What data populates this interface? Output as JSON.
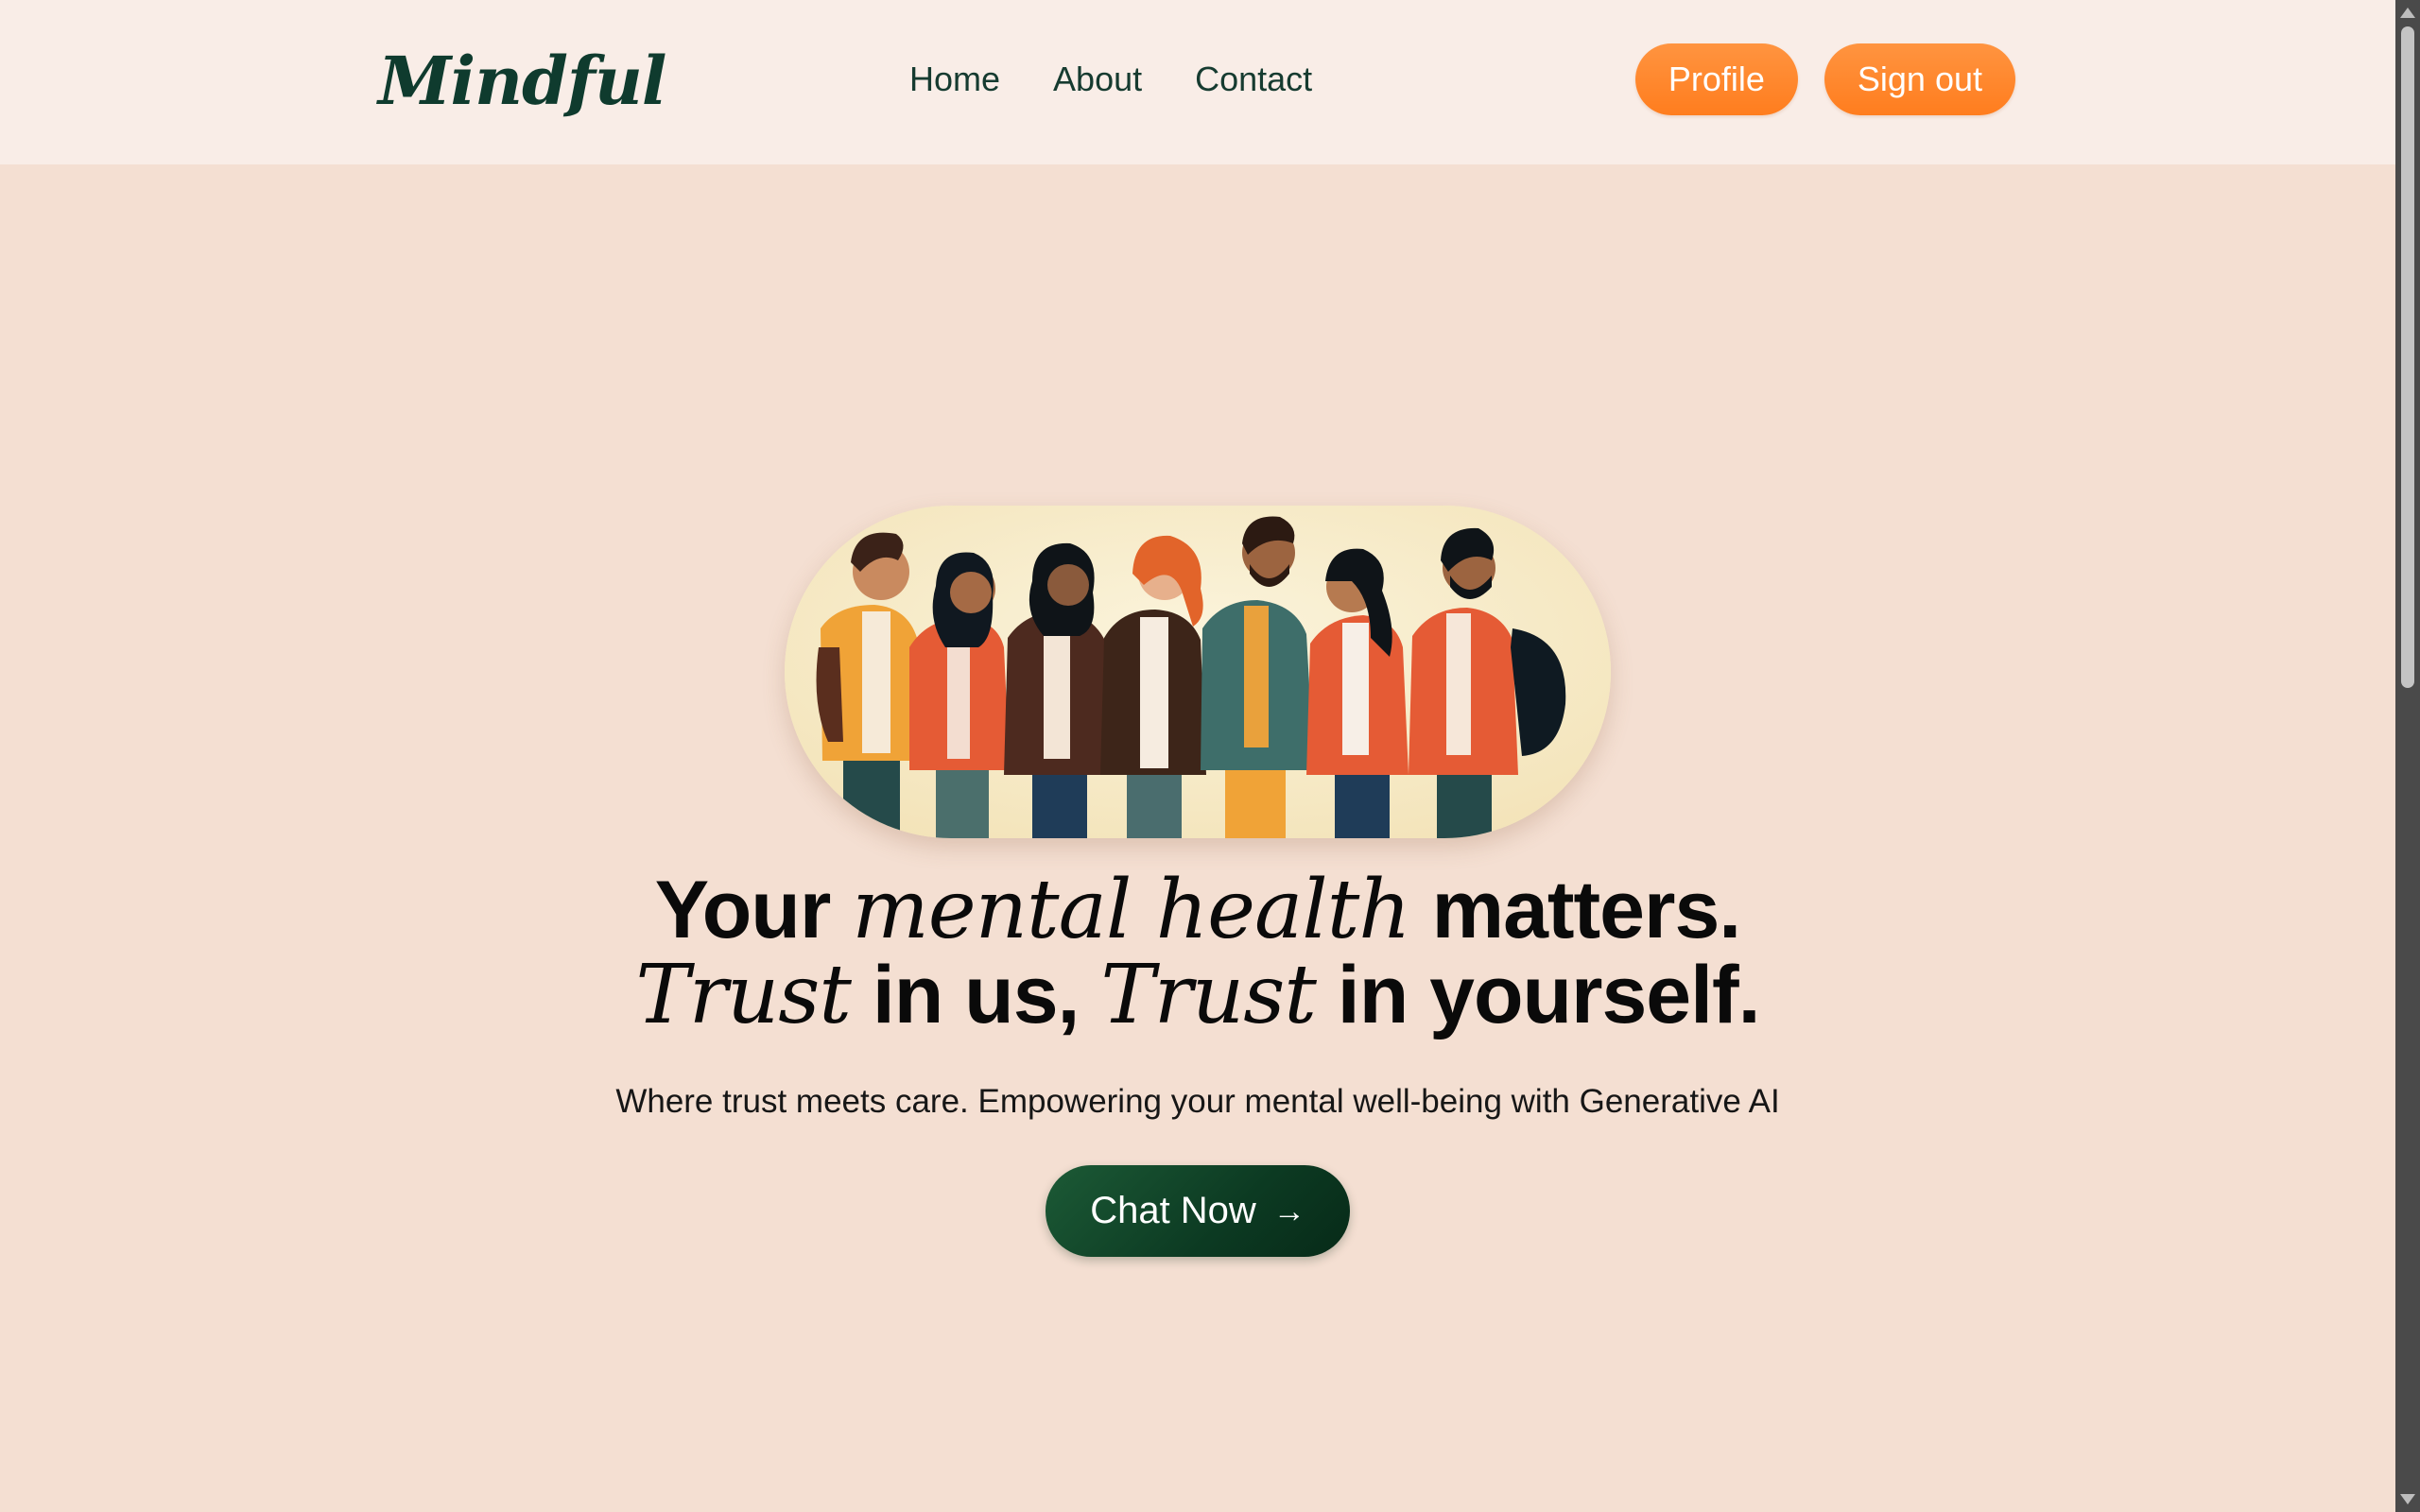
{
  "brand": {
    "name": "Mindful"
  },
  "nav": {
    "links": [
      {
        "label": "Home"
      },
      {
        "label": "About"
      },
      {
        "label": "Contact"
      }
    ]
  },
  "actions": {
    "profile_label": "Profile",
    "signout_label": "Sign out"
  },
  "hero": {
    "image_icon": "group-of-people-illustration",
    "headline": {
      "line1_a": "Your ",
      "line1_serif": "mental health",
      "line1_b": " matters.",
      "line2_serif_a": "Trust",
      "line2_a": " in us, ",
      "line2_serif_b": "Trust",
      "line2_b": " in yourself."
    },
    "subtitle": "Where trust meets care. Empowering your mental well-being with Generative AI",
    "cta_label": "Chat Now",
    "cta_icon": "arrow-right-icon"
  },
  "colors": {
    "page_background": "#f4dfd2",
    "header_background": "#f9ede7",
    "accent_orange": "#ff8a2e",
    "cta_green": "#0f4428",
    "brand_text": "#0f3b2e"
  }
}
